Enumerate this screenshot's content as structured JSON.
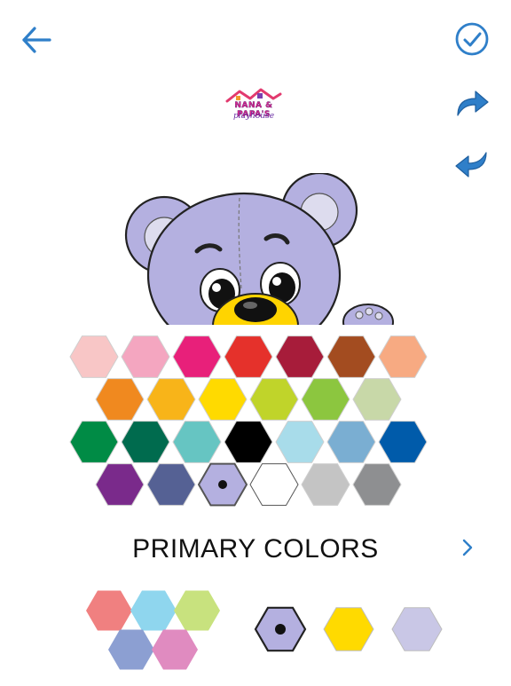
{
  "toolbar": {
    "back_icon": "arrow-left-icon",
    "done_icon": "check-circle-icon",
    "redo_icon": "redo-arrow-icon",
    "undo_icon": "undo-arrow-icon",
    "accent_color": "#2f7fc9"
  },
  "logo": {
    "title": "NANA & PAPA'S",
    "subtitle": "playhouse"
  },
  "artwork": {
    "subject": "bear-coloring-page",
    "bear_fill_color": "#b4b0e0",
    "nose_area_color": "#ffd400"
  },
  "palette": {
    "title": "PRIMARY COLORS",
    "selected_color": "#b4b0e0",
    "rows": [
      [
        "#f8c6c6",
        "#f4a6c0",
        "#e8207a",
        "#e5312b",
        "#a71c3a",
        "#a34c20",
        "#f7aa82"
      ],
      [
        "#f0891f",
        "#f8b419",
        "#ffda00",
        "#c0d42a",
        "#8cc63f",
        "#c8d8a8"
      ],
      [
        "#008b45",
        "#006b4e",
        "#66c5c2",
        "#000000",
        "#a8dcea",
        "#7aaed2",
        "#005baa"
      ],
      [
        "#7a2a8b",
        "#556194",
        "#b4b0e0",
        "#ffffff",
        "#c4c4c4",
        "#8e8f91"
      ]
    ]
  },
  "bottom": {
    "mix_colors": [
      "#f08080",
      "#8fd6ee",
      "#c8e27e",
      "#8c9fd2",
      "#e08bc0"
    ],
    "recent_colors": [
      "#b4b0e0",
      "#ffda00",
      "#c9c7e6"
    ]
  }
}
